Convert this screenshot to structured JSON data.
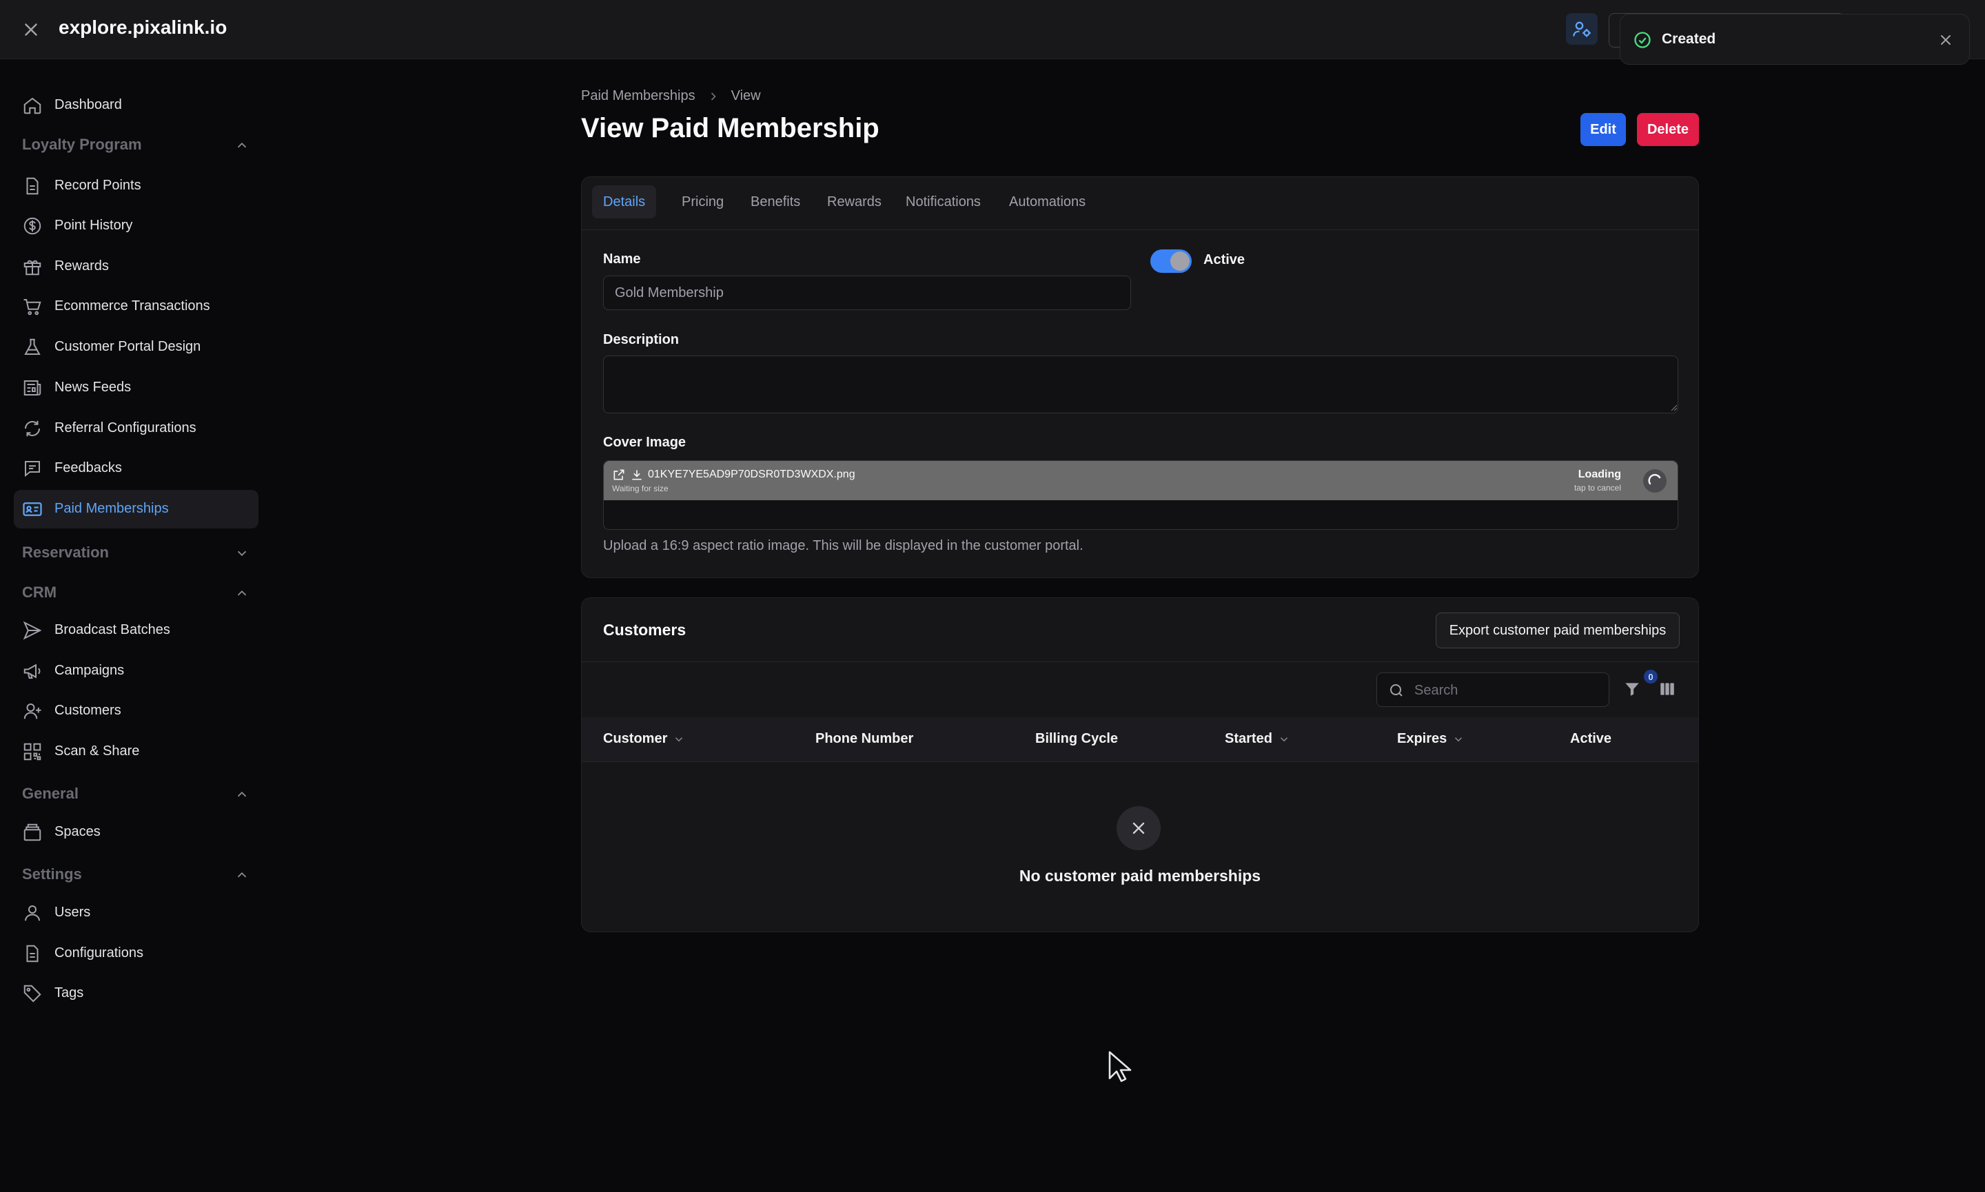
{
  "app": {
    "title": "explore.pixalink.io"
  },
  "toast": {
    "message": "Created"
  },
  "sidebar": {
    "dashboard": "Dashboard",
    "groups": {
      "loyalty": "Loyalty Program",
      "reservation": "Reservation",
      "crm": "CRM",
      "general": "General",
      "settings": "Settings"
    },
    "loyalty_items": [
      "Record Points",
      "Point History",
      "Rewards",
      "Ecommerce Transactions",
      "Customer Portal Design",
      "News Feeds",
      "Referral Configurations",
      "Feedbacks",
      "Paid Memberships"
    ],
    "crm_items": [
      "Broadcast Batches",
      "Campaigns",
      "Customers",
      "Scan & Share"
    ],
    "general_items": [
      "Spaces"
    ],
    "settings_items": [
      "Users",
      "Configurations",
      "Tags"
    ]
  },
  "breadcrumb": {
    "parent": "Paid Memberships",
    "current": "View"
  },
  "page": {
    "title": "View Paid Membership",
    "edit_label": "Edit",
    "delete_label": "Delete"
  },
  "tabs": [
    "Details",
    "Pricing",
    "Benefits",
    "Rewards",
    "Notifications",
    "Automations"
  ],
  "form": {
    "name_label": "Name",
    "name_value": "Gold Membership",
    "active_label": "Active",
    "active": true,
    "description_label": "Description",
    "description_value": "",
    "cover_label": "Cover Image",
    "file_name": "01KYE7YE5AD9P70DSR0TD3WXDX.png",
    "file_sub": "Waiting for size",
    "file_status": "Loading",
    "file_status_sub": "tap to cancel",
    "helper": "Upload a 16:9 aspect ratio image. This will be displayed in the customer portal."
  },
  "customers": {
    "title": "Customers",
    "export_label": "Export customer paid memberships",
    "search_placeholder": "Search",
    "filter_count": "0",
    "columns": [
      "Customer",
      "Phone Number",
      "Billing Cycle",
      "Started",
      "Expires",
      "Active"
    ],
    "empty_text": "No customer paid memberships"
  },
  "colors": {
    "accent": "#3b82f6",
    "danger": "#e11d48",
    "background": "#09090b",
    "success": "#4ade80"
  }
}
